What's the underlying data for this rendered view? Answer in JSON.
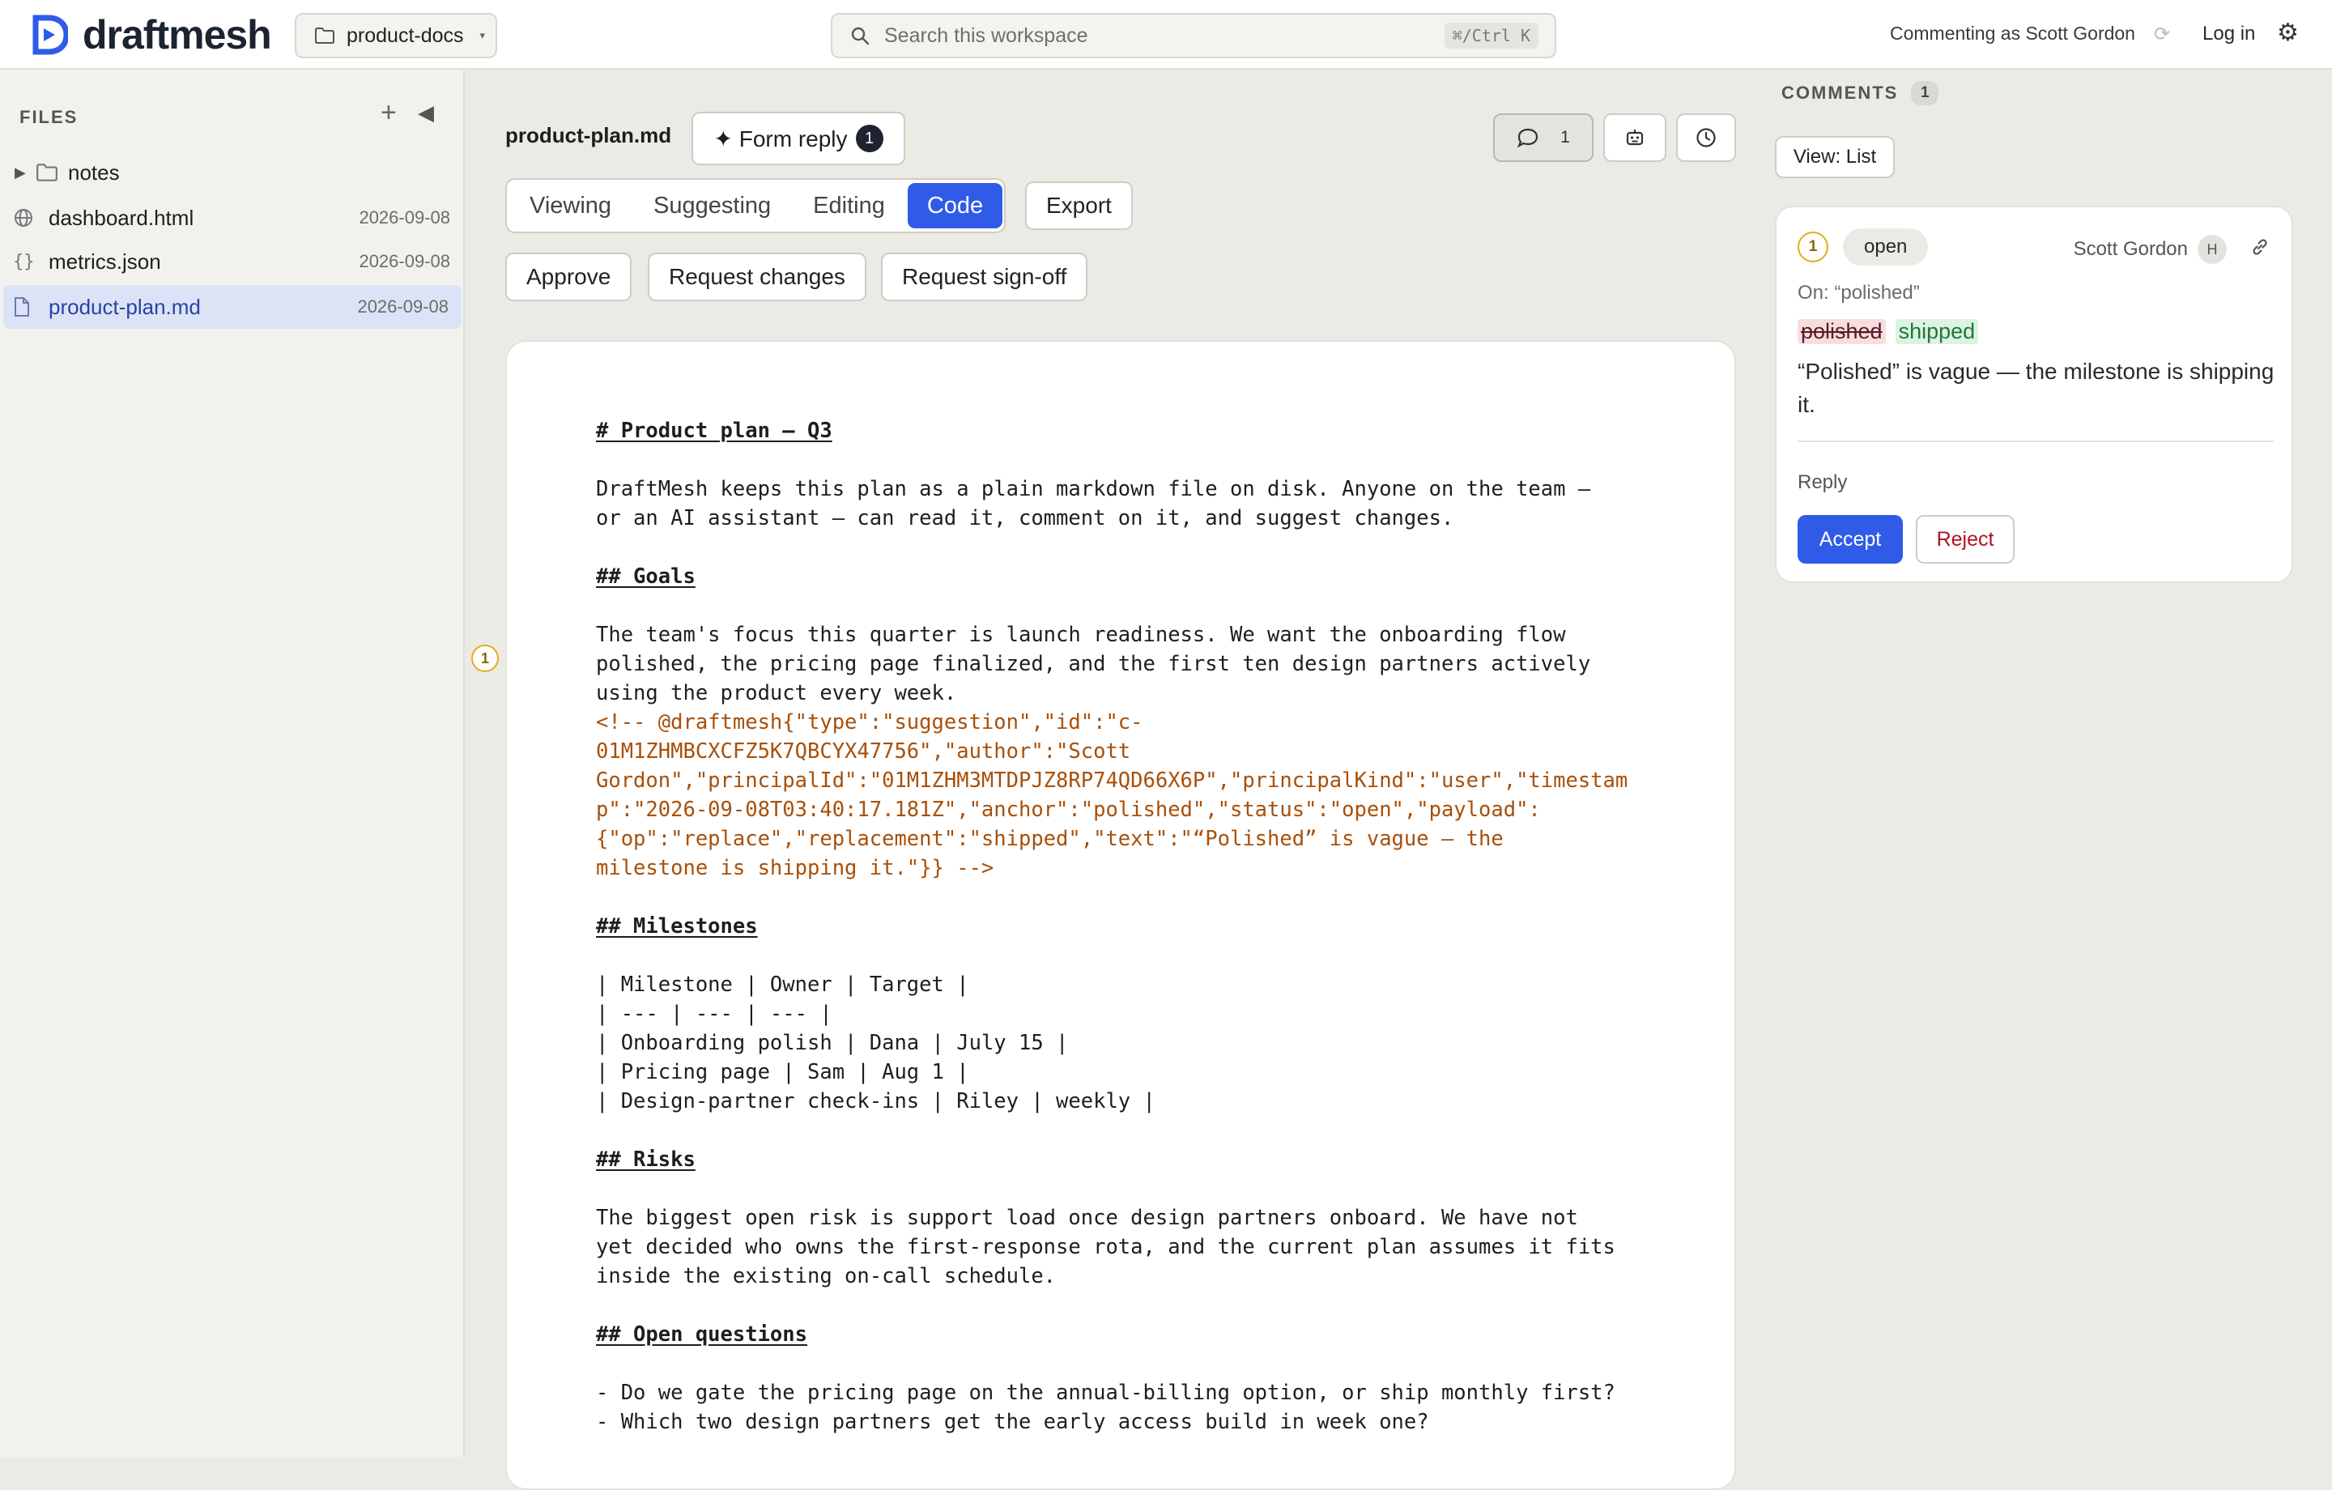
{
  "brand": {
    "name": "draftmesh",
    "accent": "#2F5BE8"
  },
  "header": {
    "workspace": "product-docs",
    "search_placeholder": "Search this workspace",
    "search_shortcut": "⌘/Ctrl K",
    "commenting_as": "Commenting as Scott Gordon",
    "login": "Log in"
  },
  "sidebar": {
    "title": "FILES",
    "items": [
      {
        "name": "notes",
        "type": "folder",
        "date": ""
      },
      {
        "name": "dashboard.html",
        "type": "html",
        "date": "2026-09-08"
      },
      {
        "name": "metrics.json",
        "type": "json",
        "date": "2026-09-08"
      },
      {
        "name": "product-plan.md",
        "type": "markdown",
        "date": "2026-09-08",
        "selected": true
      }
    ]
  },
  "doc_toolbar": {
    "filename": "product-plan.md",
    "form_reply": "✦ Form reply",
    "form_reply_count": "1",
    "comments_count": "1",
    "modes": [
      "Viewing",
      "Suggesting",
      "Editing",
      "Code"
    ],
    "active_mode": "Code",
    "export": "Export",
    "actions": [
      "Approve",
      "Request changes",
      "Request sign-off"
    ]
  },
  "document": {
    "gutter_marker": "1",
    "lines": [
      "# Product plan — Q3",
      "",
      "DraftMesh keeps this plan as a plain markdown file on disk. Anyone on the team —",
      "or an AI assistant — can read it, comment on it, and suggest changes.",
      "",
      "## Goals",
      "",
      "The team's focus this quarter is launch readiness. We want the onboarding flow",
      "polished, the pricing page finalized, and the first ten design partners actively",
      "using the product every week.",
      "<!-- @draftmesh{\"type\":\"suggestion\",\"id\":\"c-",
      "01M1ZHMBCXCFZ5K7QBCYX47756\",\"author\":\"Scott",
      "Gordon\",\"principalId\":\"01M1ZHM3MTDPJZ8RP74QD66X6P\",\"principalKind\":\"user\",\"timestam",
      "p\":\"2026-09-08T03:40:17.181Z\",\"anchor\":\"polished\",\"status\":\"open\",\"payload\":",
      "{\"op\":\"replace\",\"replacement\":\"shipped\",\"text\":\"“Polished” is vague — the",
      "milestone is shipping it.\"}} -->",
      "",
      "## Milestones",
      "",
      "| Milestone | Owner | Target |",
      "| --- | --- | --- |",
      "| Onboarding polish | Dana | July 15 |",
      "| Pricing page | Sam | Aug 1 |",
      "| Design-partner check-ins | Riley | weekly |",
      "",
      "## Risks",
      "",
      "The biggest open risk is support load once design partners onboard. We have not",
      "yet decided who owns the first-response rota, and the current plan assumes it fits",
      "inside the existing on-call schedule.",
      "",
      "## Open questions",
      "",
      "- Do we gate the pricing page on the annual-billing option, or ship monthly first?",
      "- Which two design partners get the early access build in week one?"
    ]
  },
  "comments": {
    "title": "COMMENTS",
    "count": "1",
    "view": "View: List",
    "items": [
      {
        "number": "1",
        "status": "open",
        "author": "Scott Gordon",
        "author_initial": "H",
        "anchor": "On: “polished”",
        "deleted": "polished",
        "inserted": "shipped",
        "text": "“Polished” is vague — the milestone is shipping it.",
        "reply": "Reply",
        "accept": "Accept",
        "reject": "Reject"
      }
    ]
  }
}
